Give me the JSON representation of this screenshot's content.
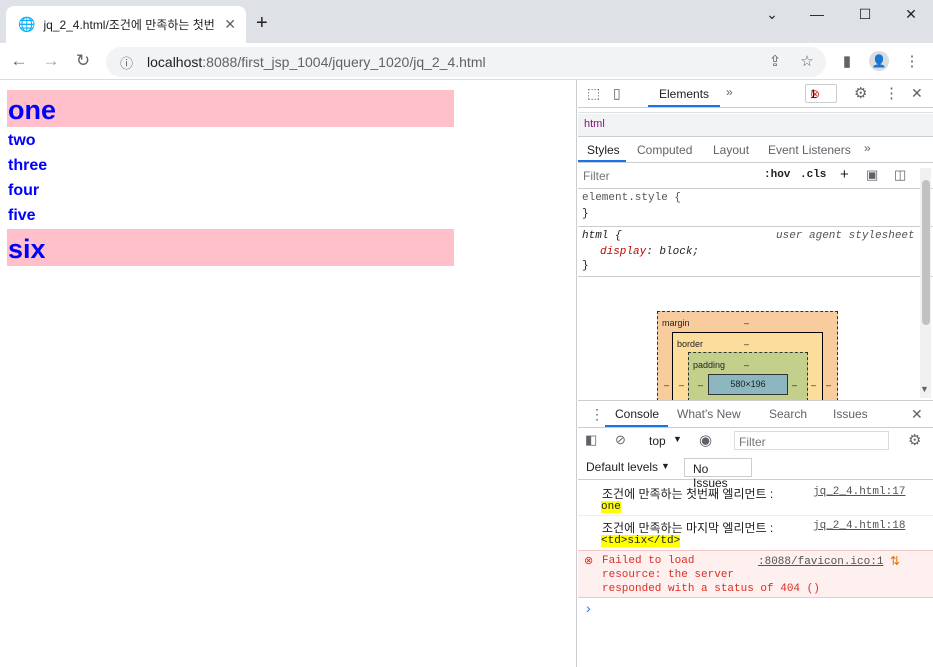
{
  "browser": {
    "tab_title": "jq_2_4.html/조건에 만족하는 첫번",
    "url_host": "localhost",
    "url_path": ":8088/first_jsp_1004/jquery_1020/jq_2_4.html"
  },
  "page": {
    "items": [
      "one",
      "two",
      "three",
      "four",
      "five",
      "six"
    ]
  },
  "devtools": {
    "top_tab": "Elements",
    "error_count": "1",
    "breadcrumb": "html",
    "styles_tabs": [
      "Styles",
      "Computed",
      "Layout",
      "Event Listeners"
    ],
    "filter_placeholder": "Filter",
    "hov": ":hov",
    "cls": ".cls",
    "rule1_selector": "element.style {",
    "rule1_close": "}",
    "rule2_selector": "html {",
    "rule2_source": "user agent stylesheet",
    "rule2_prop": "display",
    "rule2_value": "block;",
    "rule2_close": "}",
    "box": {
      "margin": "margin",
      "border": "border",
      "padding": "padding",
      "dash": "–",
      "content": "580×196"
    },
    "drawer_tabs": [
      "Console",
      "What's New",
      "Search",
      "Issues"
    ],
    "context": "top",
    "console_filter_placeholder": "Filter",
    "default_levels": "Default levels",
    "no_issues": "No Issues",
    "logs": [
      {
        "text": "조건에 만족하는 첫번째 엘리먼트 :",
        "source": "jq_2_4.html:17",
        "value": "one"
      },
      {
        "text": "조건에 만족하는 마지막 엘리먼트 :",
        "source": "jq_2_4.html:18",
        "value": "<td>six</td>"
      }
    ],
    "error": {
      "line1": "Failed to load",
      "line2": "resource: the server",
      "line3": "responded with a status of 404 ()",
      "source": ":8088/favicon.ico:1"
    },
    "prompt": "›"
  }
}
